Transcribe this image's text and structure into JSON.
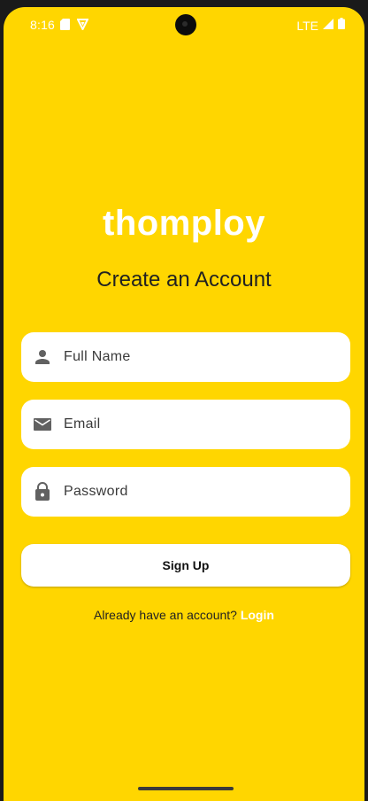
{
  "status_bar": {
    "time": "8:16",
    "network": "LTE",
    "icons": [
      "sd-card-icon",
      "vpn-shield-icon",
      "signal-icon",
      "battery-icon"
    ]
  },
  "app": {
    "logo": "thomploy",
    "heading": "Create an Account"
  },
  "form": {
    "name": {
      "placeholder": "Full Name",
      "value": "",
      "icon": "person-icon"
    },
    "email": {
      "placeholder": "Email",
      "value": "",
      "icon": "mail-icon"
    },
    "password": {
      "placeholder": "Password",
      "value": "",
      "icon": "lock-icon"
    },
    "submit_label": "Sign Up"
  },
  "footer": {
    "prompt": "Already have an account?",
    "login_label": "Login"
  },
  "colors": {
    "background": "#FFD600",
    "card": "#FFFFFF",
    "icon": "#616161",
    "link": "#FFFFFF"
  }
}
